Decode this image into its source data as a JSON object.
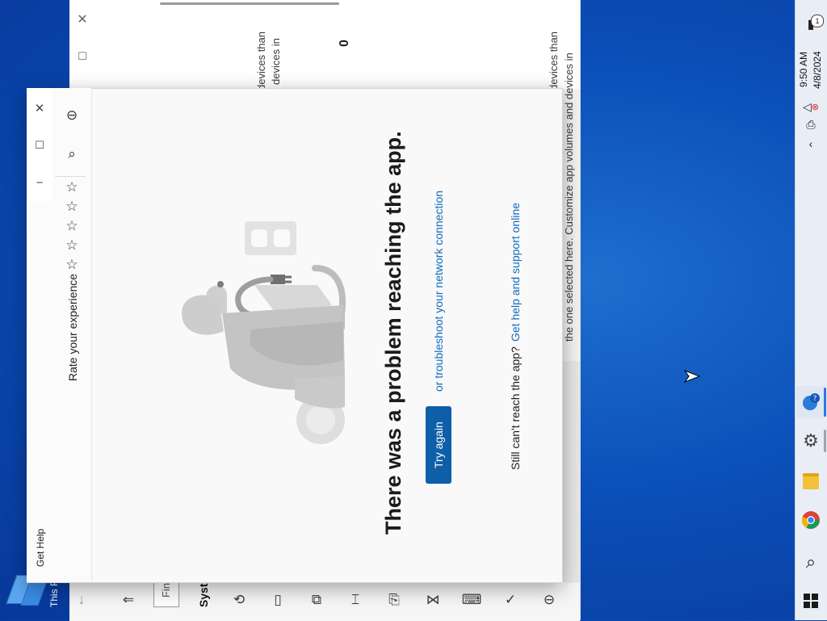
{
  "settings_window": {
    "device_text_top": "devices than",
    "device_text_mid": "devices in",
    "counter": "0",
    "customize_line1": "devices than",
    "customize_line2": "the one selected here. Customize app volumes and devices in",
    "find_placeholder": "Fin",
    "system_label": "Syste",
    "this_pc_label": "This P"
  },
  "get_help": {
    "app_title": "Get Help",
    "rate_label": "Rate your experience",
    "stars": [
      "☆",
      "☆",
      "☆",
      "☆",
      "☆"
    ],
    "heading": "There was a problem reaching the app.",
    "troubleshoot_link": "or troubleshoot your network connection",
    "try_again": "Try again",
    "still_cant": "Still can't reach the app?",
    "support_link": "Get help and support online"
  },
  "taskbar": {
    "time": "9:50 AM",
    "date": "4/8/2024",
    "notification_count": "1"
  }
}
